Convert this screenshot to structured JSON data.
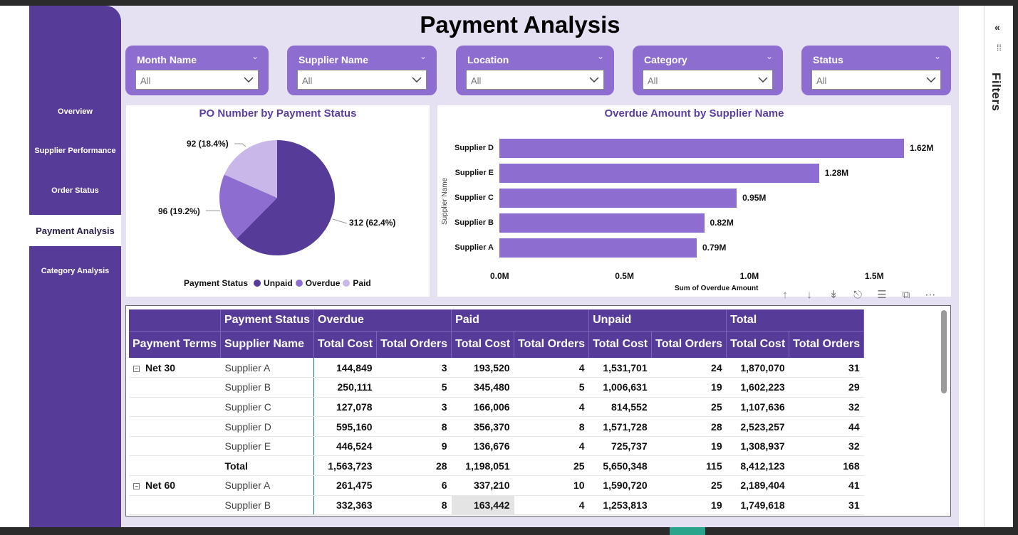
{
  "page_title": "Payment Analysis",
  "nav": {
    "items": [
      "Overview",
      "Supplier Performance",
      "Order Status",
      "Payment Analysis",
      "Category Analysis"
    ],
    "active": "Payment Analysis"
  },
  "slicers": [
    {
      "label": "Month Name",
      "value": "All"
    },
    {
      "label": "Supplier Name",
      "value": "All"
    },
    {
      "label": "Location",
      "value": "All"
    },
    {
      "label": "Category",
      "value": "All"
    },
    {
      "label": "Status",
      "value": "All"
    }
  ],
  "chart_data": [
    {
      "type": "pie",
      "title": "PO Number by Payment Status",
      "slices": [
        {
          "label": "Unpaid",
          "value": 312,
          "display": "312 (62.4%)",
          "color": "#573b98"
        },
        {
          "label": "Overdue",
          "value": 96,
          "display": "96 (19.2%)",
          "color": "#8e6dd0"
        },
        {
          "label": "Paid",
          "value": 92,
          "display": "92 (18.4%)",
          "color": "#c8b7e8"
        }
      ],
      "legend_title": "Payment Status",
      "legend_position": "bottom"
    },
    {
      "type": "bar",
      "orientation": "horizontal",
      "title": "Overdue Amount by Supplier Name",
      "categories": [
        "Supplier D",
        "Supplier E",
        "Supplier C",
        "Supplier B",
        "Supplier A"
      ],
      "values": [
        1.62,
        1.28,
        0.95,
        0.82,
        0.79
      ],
      "value_labels": [
        "1.62M",
        "1.28M",
        "0.95M",
        "0.82M",
        "0.79M"
      ],
      "xlabel": "Sum of Overdue Amount",
      "ylabel": "Supplier Name",
      "xlim": [
        0,
        1.75
      ],
      "x_ticks": [
        "0.0M",
        "0.5M",
        "1.0M",
        "1.5M"
      ],
      "color": "#8e6dd0"
    }
  ],
  "table": {
    "group_headers": [
      "",
      "Payment Status",
      "Overdue",
      "",
      "Paid",
      "",
      "Unpaid",
      "",
      "Total",
      ""
    ],
    "col_headers": [
      "Payment Terms",
      "Supplier Name",
      "Total Cost",
      "Total Orders",
      "Total Cost",
      "Total Orders",
      "Total Cost",
      "Total Orders",
      "Total Cost",
      "Total Orders"
    ],
    "rows": [
      {
        "term": "Net 30",
        "supplier": "Supplier A",
        "vals": [
          "144,849",
          "3",
          "193,520",
          "4",
          "1,531,701",
          "24",
          "1,870,070",
          "31"
        ]
      },
      {
        "term": "",
        "supplier": "Supplier B",
        "vals": [
          "250,111",
          "5",
          "345,480",
          "5",
          "1,006,631",
          "19",
          "1,602,223",
          "29"
        ]
      },
      {
        "term": "",
        "supplier": "Supplier C",
        "vals": [
          "127,078",
          "3",
          "166,006",
          "4",
          "814,552",
          "25",
          "1,107,636",
          "32"
        ]
      },
      {
        "term": "",
        "supplier": "Supplier D",
        "vals": [
          "595,160",
          "8",
          "356,370",
          "8",
          "1,571,728",
          "28",
          "2,523,257",
          "44"
        ]
      },
      {
        "term": "",
        "supplier": "Supplier E",
        "vals": [
          "446,524",
          "9",
          "136,676",
          "4",
          "725,737",
          "19",
          "1,308,937",
          "32"
        ]
      },
      {
        "term": "",
        "supplier": "Total",
        "subtotal": true,
        "vals": [
          "1,563,723",
          "28",
          "1,198,051",
          "25",
          "5,650,348",
          "115",
          "8,412,123",
          "168"
        ]
      },
      {
        "term": "Net 60",
        "supplier": "Supplier A",
        "vals": [
          "261,475",
          "6",
          "337,210",
          "10",
          "1,590,720",
          "25",
          "2,189,404",
          "41"
        ]
      },
      {
        "term": "",
        "supplier": "Supplier B",
        "vals": [
          "332,363",
          "8",
          "163,442",
          "4",
          "1,253,813",
          "19",
          "1,749,618",
          "31"
        ]
      }
    ]
  },
  "filters_panel": {
    "label": "Filters",
    "collapse": "«"
  },
  "colors": {
    "nav": "#573b98",
    "accent": "#8e6dd0",
    "canvas": "#e6e1f2"
  }
}
